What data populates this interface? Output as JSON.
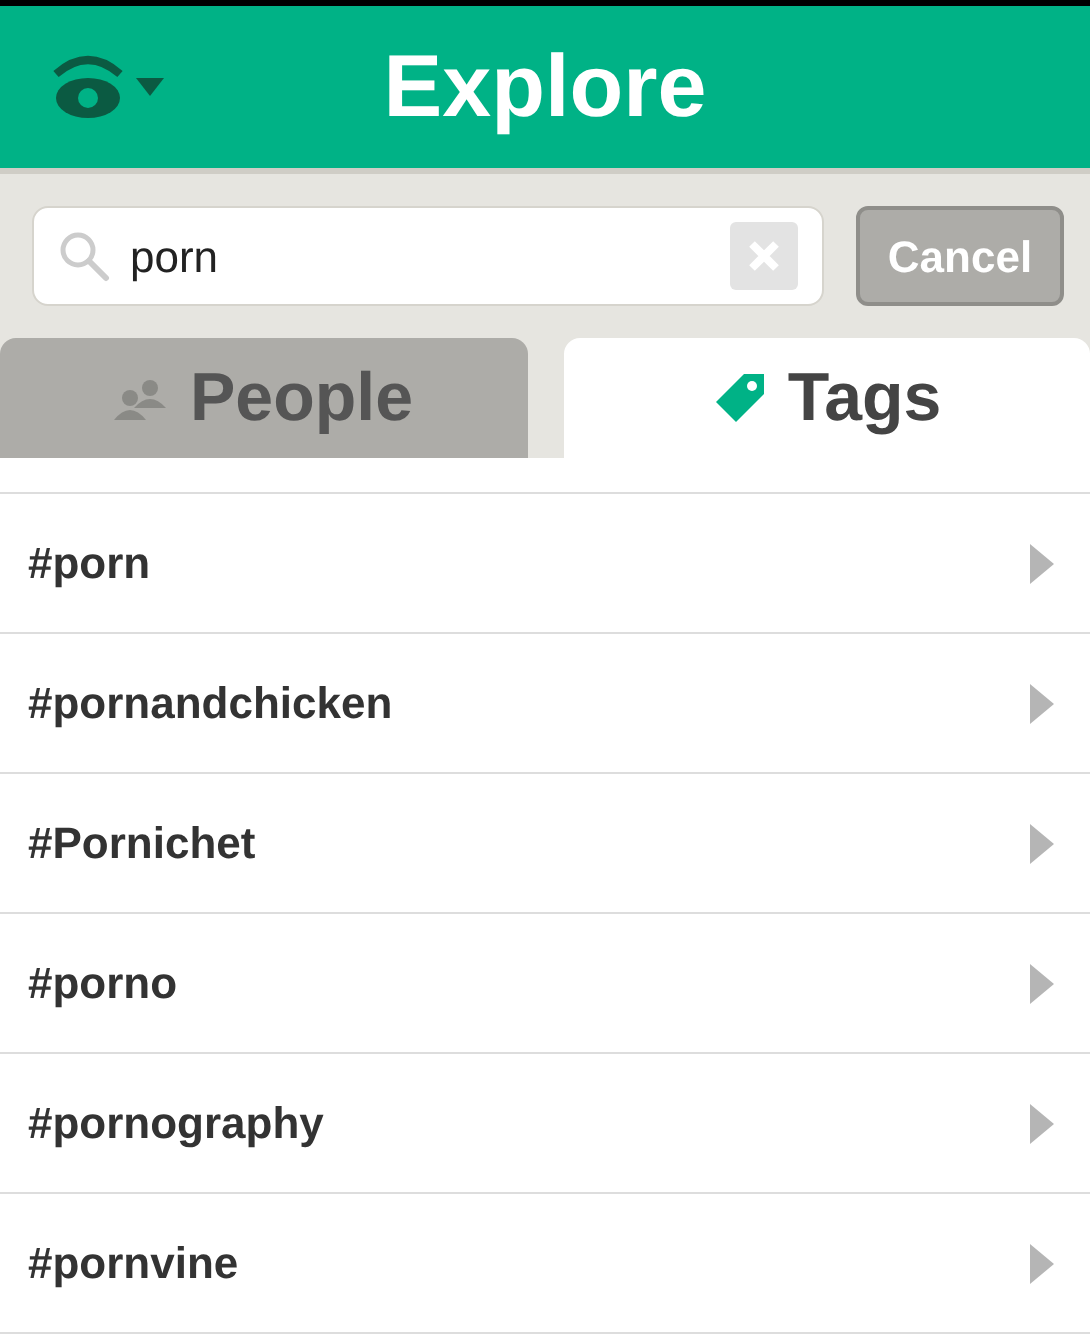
{
  "header": {
    "title": "Explore"
  },
  "search": {
    "value": "porn"
  },
  "cancel_button": "Cancel",
  "tabs": [
    {
      "label": "People",
      "kind": "people",
      "selected": false
    },
    {
      "label": "Tags",
      "kind": "tags",
      "selected": true
    }
  ],
  "results": [
    "#porn",
    "#pornandchicken",
    "#Pornichet",
    "#porno",
    "#pornography",
    "#pornvine"
  ]
}
